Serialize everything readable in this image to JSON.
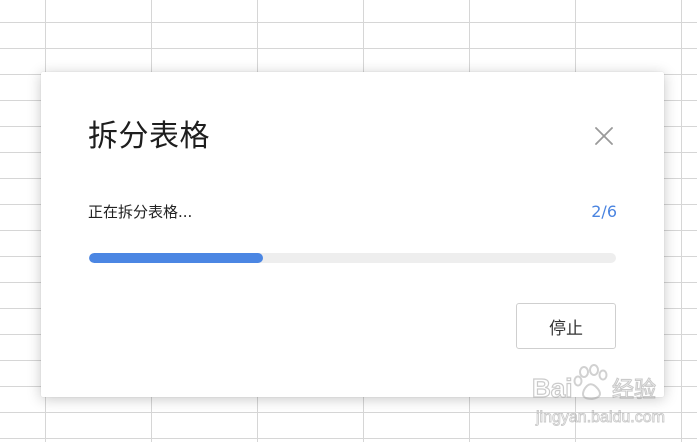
{
  "dialog": {
    "title": "拆分表格",
    "status_text": "正在拆分表格...",
    "progress_text": "2/6",
    "progress": {
      "current": 2,
      "total": 6,
      "fraction_shown": 0.33
    },
    "stop_label": "停止",
    "close_icon": "close-icon"
  },
  "watermark": {
    "logo_text": "Baidu经验",
    "url_text": "jingyan.baidu.com"
  },
  "colors": {
    "accent": "#4b86e3",
    "progress_text": "#4a84e0",
    "grid_line": "#d6d6d6",
    "track": "#eeeeee"
  }
}
